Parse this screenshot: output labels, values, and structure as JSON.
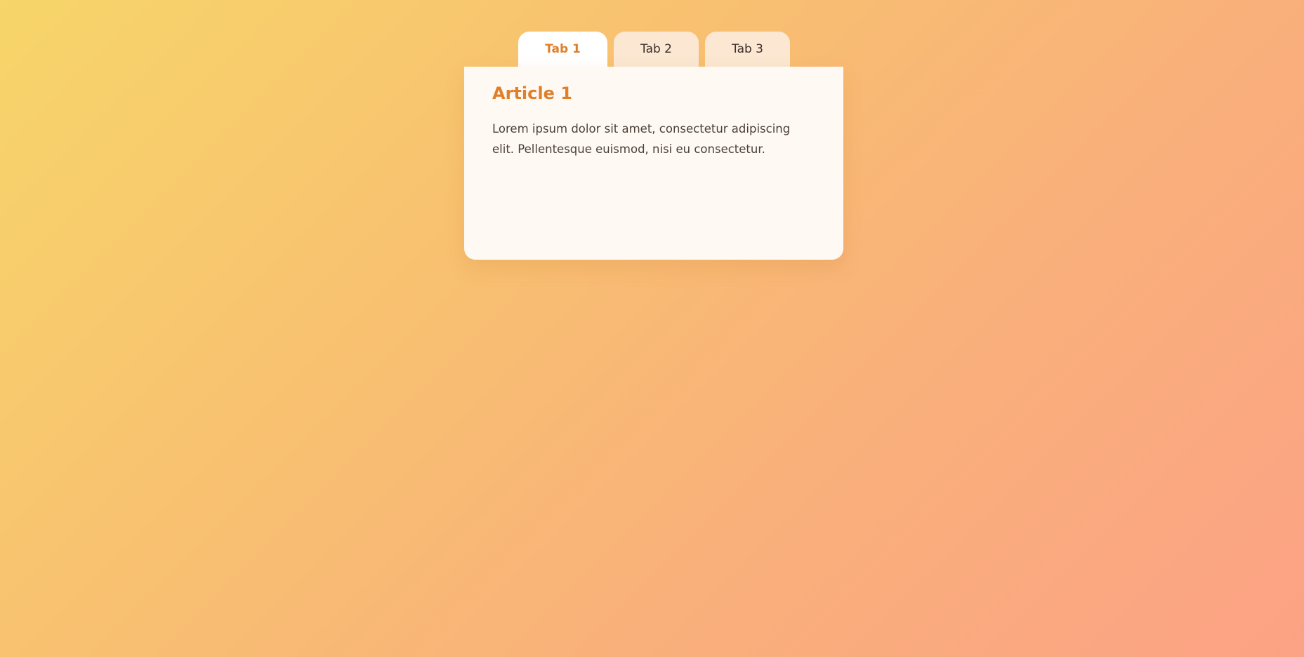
{
  "tabs": [
    {
      "label": "Tab 1",
      "active": true
    },
    {
      "label": "Tab 2",
      "active": false
    },
    {
      "label": "Tab 3",
      "active": false
    }
  ],
  "article": {
    "title": "Article 1",
    "body": "Lorem ipsum dolor sit amet, consectetur adipiscing elit. Pellentesque euismod, nisi eu consectetur."
  },
  "colors": {
    "accent": "#e07f2a",
    "active_tab_bg": "#ffffff",
    "inactive_tab_bg": "#fbe7d2",
    "panel_bg": "#fff9f4"
  }
}
